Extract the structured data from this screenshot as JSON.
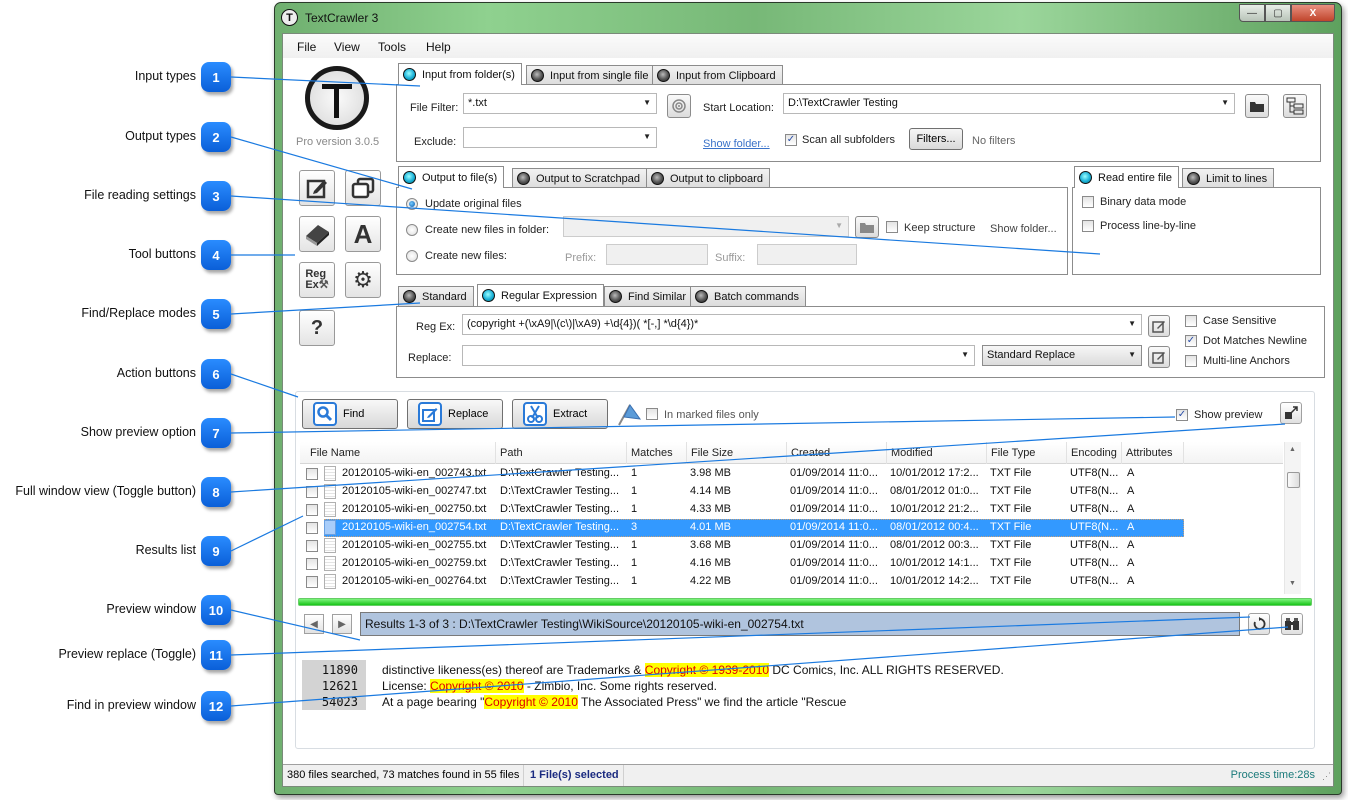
{
  "callouts": [
    {
      "num": "1",
      "label": "Input types"
    },
    {
      "num": "2",
      "label": "Output types"
    },
    {
      "num": "3",
      "label": "File reading settings"
    },
    {
      "num": "4",
      "label": "Tool buttons"
    },
    {
      "num": "5",
      "label": "Find/Replace modes"
    },
    {
      "num": "6",
      "label": "Action buttons"
    },
    {
      "num": "7",
      "label": "Show preview option"
    },
    {
      "num": "8",
      "label": "Full window view (Toggle button)"
    },
    {
      "num": "9",
      "label": "Results list"
    },
    {
      "num": "10",
      "label": "Preview window"
    },
    {
      "num": "11",
      "label": "Preview replace (Toggle)"
    },
    {
      "num": "12",
      "label": "Find in preview window"
    }
  ],
  "window": {
    "title": "TextCrawler 3",
    "icon_letter": "T",
    "controls": {
      "minimize": "—",
      "maximize": "▢",
      "close": "X"
    }
  },
  "menu": [
    "File",
    "View",
    "Tools",
    "Help"
  ],
  "branding": {
    "version": "Pro version 3.0.5"
  },
  "tool_buttons": [
    {
      "icon": "edit-icon",
      "glyph": "✎"
    },
    {
      "icon": "windows-icon",
      "glyph": "❐"
    },
    {
      "icon": "book-icon",
      "glyph": "📕"
    },
    {
      "icon": "font-icon",
      "glyph": "A"
    },
    {
      "icon": "regex-tool-icon",
      "glyph": "Reg Ex"
    },
    {
      "icon": "gear-icon",
      "glyph": "⚙"
    },
    {
      "icon": "help-icon",
      "glyph": "?"
    }
  ],
  "input": {
    "tabs": [
      "Input from folder(s)",
      "Input from single file",
      "Input from Clipboard"
    ],
    "active_tab": 0,
    "file_filter_label": "File Filter:",
    "file_filter_value": "*.txt",
    "start_location_label": "Start Location:",
    "start_location_value": "D:\\TextCrawler Testing",
    "exclude_label": "Exclude:",
    "exclude_value": "",
    "show_folder_link": "Show folder...",
    "scan_subfolders_label": "Scan all subfolders",
    "scan_subfolders_checked": true,
    "filters_button": "Filters...",
    "filters_status": "No filters"
  },
  "output": {
    "tabs": [
      "Output to file(s)",
      "Output to Scratchpad",
      "Output to clipboard"
    ],
    "active_tab": 0,
    "options": [
      {
        "label": "Update original files",
        "selected": true
      },
      {
        "label": "Create new files in folder:",
        "selected": false
      },
      {
        "label": "Create new files:",
        "selected": false
      }
    ],
    "keep_structure_label": "Keep structure",
    "show_folder_label": "Show folder...",
    "prefix_label": "Prefix:",
    "suffix_label": "Suffix:"
  },
  "reading": {
    "tabs": [
      "Read entire file",
      "Limit to lines"
    ],
    "active_tab": 0,
    "binary_label": "Binary data mode",
    "line_by_line_label": "Process line-by-line"
  },
  "mode": {
    "tabs": [
      "Standard",
      "Regular Expression",
      "Find Similar",
      "Batch commands"
    ],
    "active_tab": 1,
    "regex_label": "Reg Ex:",
    "regex_value": "(copyright +(\\xA9|\\(c\\)|\\xA9) +\\d{4})( *[-,] *\\d{4})*",
    "replace_label": "Replace:",
    "replace_value": "",
    "replace_mode": "Standard Replace",
    "case_sensitive_label": "Case Sensitive",
    "case_sensitive": false,
    "dot_newline_label": "Dot Matches Newline",
    "dot_newline": true,
    "multiline_label": "Multi-line Anchors",
    "multiline": false
  },
  "actions": {
    "find": "Find",
    "replace": "Replace",
    "extract": "Extract",
    "marked_only_label": "In marked files only",
    "show_preview_label": "Show preview",
    "show_preview_checked": true
  },
  "results": {
    "columns": [
      "File Name",
      "Path",
      "Matches",
      "File Size",
      "Created",
      "Modified",
      "File Type",
      "Encoding",
      "Attributes"
    ],
    "rows": [
      {
        "name": "20120105-wiki-en_002743.txt",
        "path": "D:\\TextCrawler Testing...",
        "matches": "1",
        "size": "3.98 MB",
        "created": "01/09/2014 11:0...",
        "modified": "10/01/2012 17:2...",
        "type": "TXT File",
        "encoding": "UTF8(N...",
        "attr": "A",
        "selected": false
      },
      {
        "name": "20120105-wiki-en_002747.txt",
        "path": "D:\\TextCrawler Testing...",
        "matches": "1",
        "size": "4.14 MB",
        "created": "01/09/2014 11:0...",
        "modified": "08/01/2012 01:0...",
        "type": "TXT File",
        "encoding": "UTF8(N...",
        "attr": "A",
        "selected": false
      },
      {
        "name": "20120105-wiki-en_002750.txt",
        "path": "D:\\TextCrawler Testing...",
        "matches": "1",
        "size": "4.33 MB",
        "created": "01/09/2014 11:0...",
        "modified": "10/01/2012 21:2...",
        "type": "TXT File",
        "encoding": "UTF8(N...",
        "attr": "A",
        "selected": false
      },
      {
        "name": "20120105-wiki-en_002754.txt",
        "path": "D:\\TextCrawler Testing...",
        "matches": "3",
        "size": "4.01 MB",
        "created": "01/09/2014 11:0...",
        "modified": "08/01/2012 00:4...",
        "type": "TXT File",
        "encoding": "UTF8(N...",
        "attr": "A",
        "selected": true
      },
      {
        "name": "20120105-wiki-en_002755.txt",
        "path": "D:\\TextCrawler Testing...",
        "matches": "1",
        "size": "3.68 MB",
        "created": "01/09/2014 11:0...",
        "modified": "08/01/2012 00:3...",
        "type": "TXT File",
        "encoding": "UTF8(N...",
        "attr": "A",
        "selected": false
      },
      {
        "name": "20120105-wiki-en_002759.txt",
        "path": "D:\\TextCrawler Testing...",
        "matches": "1",
        "size": "4.16 MB",
        "created": "01/09/2014 11:0...",
        "modified": "10/01/2012 14:1...",
        "type": "TXT File",
        "encoding": "UTF8(N...",
        "attr": "A",
        "selected": false
      },
      {
        "name": "20120105-wiki-en_002764.txt",
        "path": "D:\\TextCrawler Testing...",
        "matches": "1",
        "size": "4.22 MB",
        "created": "01/09/2014 11:0...",
        "modified": "10/01/2012 14:2...",
        "type": "TXT File",
        "encoding": "UTF8(N...",
        "attr": "A",
        "selected": false
      }
    ],
    "progress_percent": 100
  },
  "preview": {
    "results_text": "Results 1-3 of 3 : D:\\TextCrawler Testing\\WikiSource\\20120105-wiki-en_002754.txt",
    "lines": [
      {
        "line_no": "11890",
        "before": "distinctive likeness(es) thereof are Trademarks & ",
        "match": "Copyright © 1939-2010",
        "after": " DC Comics, Inc. ALL RIGHTS RESERVED."
      },
      {
        "line_no": "12621",
        "before": "License: ",
        "match": "Copyright © 2010",
        "after": " - Zimbio, Inc. Some rights reserved."
      },
      {
        "line_no": "54023",
        "before": "At a page bearing \"",
        "match": "Copyright © 2010",
        "after": " The Associated Press\" we find the article \"Rescue"
      }
    ],
    "highlight_color": "#ffff00",
    "match_text_color": "#e00000"
  },
  "status": {
    "summary": "380 files searched, 73 matches found in 55 files",
    "selection": "1 File(s) selected",
    "process_time": "Process time:28s"
  }
}
